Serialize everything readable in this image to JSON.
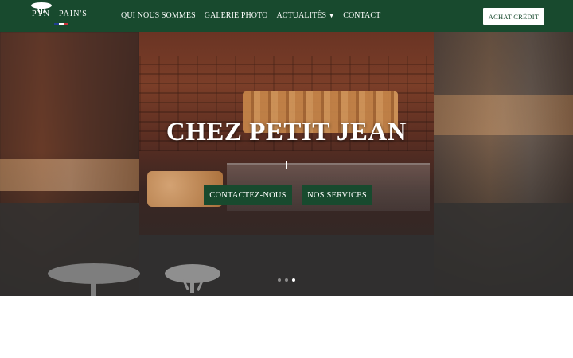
{
  "header": {
    "logo": {
      "left_text": "PYN",
      "right_text": "PAIN'S",
      "flag_colors": [
        "#1f3f8f",
        "#ffffff",
        "#c8323a"
      ],
      "icon": "tree-icon"
    },
    "nav": [
      {
        "label": "QUI NOUS SOMMES"
      },
      {
        "label": "GALERIE PHOTO"
      },
      {
        "label": "ACTUALITÉS",
        "has_dropdown": true
      },
      {
        "label": "CONTACT"
      }
    ],
    "cta_label": "ACHAT CRÉDIT"
  },
  "hero": {
    "title": "CHEZ PETIT JEAN",
    "buttons": {
      "contact_label": "CONTACTEZ-NOUS",
      "services_label": "NOS SERVICES"
    },
    "slider": {
      "count": 3,
      "active_index": 2
    }
  },
  "colors": {
    "brand_green": "#184a2e",
    "white": "#ffffff"
  }
}
